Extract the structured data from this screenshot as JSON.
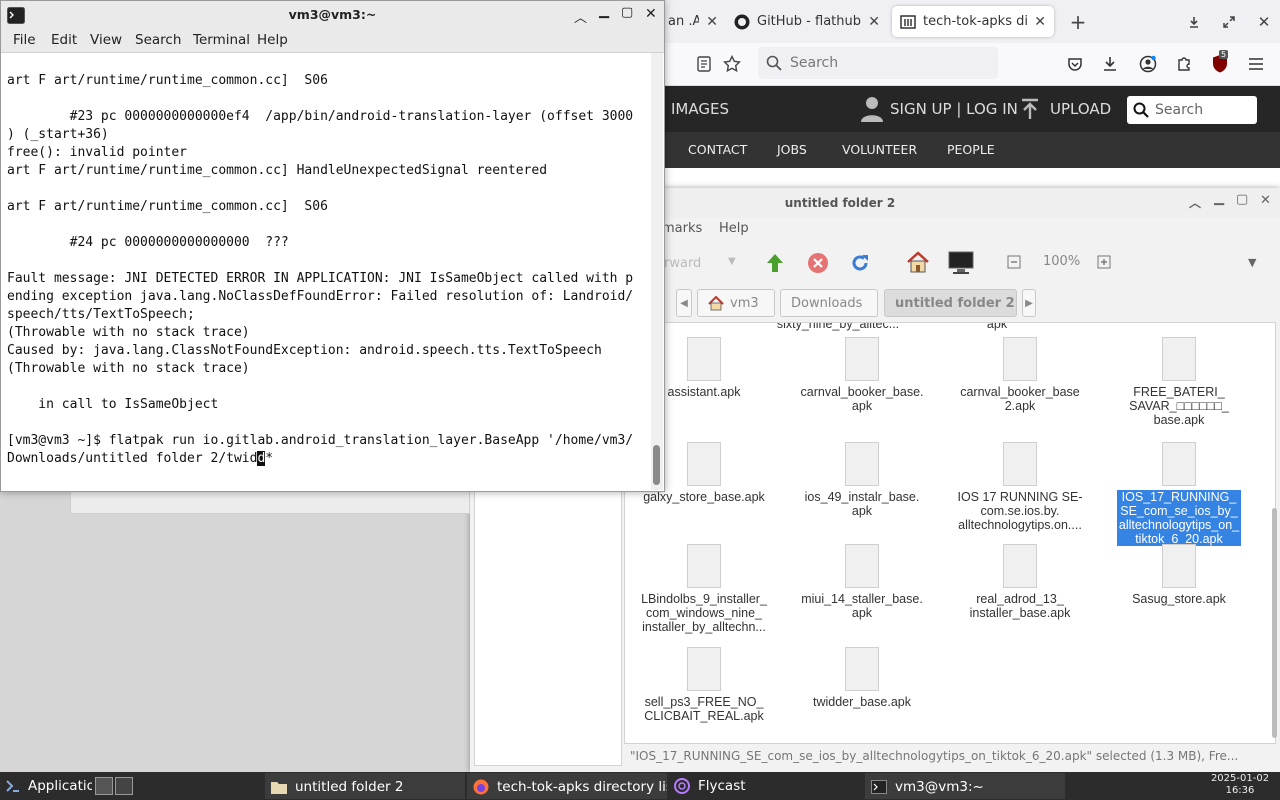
{
  "firefox": {
    "tabs": [
      {
        "label": "an .A",
        "active": false
      },
      {
        "label": "GitHub - flathub/io",
        "active": false
      },
      {
        "label": "tech-tok-apks dire",
        "active": true
      }
    ],
    "search_placeholder": "Search",
    "notification_badge": "5",
    "site": {
      "nav_images": "IMAGES",
      "sign_in": "SIGN UP | LOG IN",
      "upload": "UPLOAD",
      "search_placeholder": "Search",
      "subnav": [
        "CONTACT",
        "JOBS",
        "VOLUNTEER",
        "PEOPLE"
      ]
    }
  },
  "file_manager": {
    "title": "untitled folder 2",
    "menu": [
      "marks",
      "Help"
    ],
    "toolbar": {
      "forward": "rward",
      "zoom": "100%"
    },
    "breadcrumbs": [
      "vm3",
      "Downloads",
      "untitled folder 2"
    ],
    "partial_top": [
      "sixty_nine_by_alltec...",
      "apk"
    ],
    "files": [
      {
        "name": "assistant.apk",
        "selected": false
      },
      {
        "name": "carnval_booker_base.\napk",
        "selected": false
      },
      {
        "name": "carnval_booker_base\n2.apk",
        "selected": false
      },
      {
        "name": "FREE_BATERI_\nSAVAR_□□□□□□_\nbase.apk",
        "selected": false
      },
      {
        "name": "galxy_store_base.apk",
        "selected": false
      },
      {
        "name": "ios_49_instalr_base.\napk",
        "selected": false
      },
      {
        "name": "IOS 17 RUNNING SE-\ncom.se.ios.by.\nalltechnologytips.on....",
        "selected": false
      },
      {
        "name": "IOS_17_RUNNING_\nSE_com_se_ios_by_\nalltechnologytips_on_\ntiktok_6_20.apk",
        "selected": true
      },
      {
        "name": "LBindolbs_9_installer_\ncom_windows_nine_\ninstaller_by_alltechn...",
        "selected": false
      },
      {
        "name": "miui_14_staller_base.\napk",
        "selected": false
      },
      {
        "name": "real_adrod_13_\ninstaller_base.apk",
        "selected": false
      },
      {
        "name": "Sasug_store.apk",
        "selected": false
      },
      {
        "name": "sell_ps3_FREE_NO_\nCLICBAIT_REAL.apk",
        "selected": false
      },
      {
        "name": "twidder_base.apk",
        "selected": false
      }
    ],
    "status": "\"IOS_17_RUNNING_SE_com_se_ios_by_alltechnologytips_on_tiktok_6_20.apk\" selected (1.3 MB), Fre..."
  },
  "terminal": {
    "title": "vm3@vm3:~",
    "menu": [
      "File",
      "Edit",
      "View",
      "Search",
      "Terminal",
      "Help"
    ],
    "lines": [
      "",
      "art F art/runtime/runtime_common.cc]  S06",
      "",
      "        #23 pc 0000000000000ef4  /app/bin/android-translation-layer (offset 3000",
      ") (_start+36)",
      "free(): invalid pointer",
      "art F art/runtime/runtime_common.cc] HandleUnexpectedSignal reentered",
      "",
      "art F art/runtime/runtime_common.cc]  S06",
      "",
      "        #24 pc 0000000000000000  ???",
      "",
      "Fault message: JNI DETECTED ERROR IN APPLICATION: JNI IsSameObject called with p",
      "ending exception java.lang.NoClassDefFoundError: Failed resolution of: Landroid/",
      "speech/tts/TextToSpeech;",
      "(Throwable with no stack trace)",
      "Caused by: java.lang.ClassNotFoundException: android.speech.tts.TextToSpeech",
      "(Throwable with no stack trace)",
      "",
      "    in call to IsSameObject",
      "",
      "[vm3@vm3 ~]$ flatpak run io.gitlab.android_translation_layer.BaseApp '/home/vm3/"
    ],
    "last_line_before": "Downloads/untitled folder 2/twid",
    "last_line_cursor": "d",
    "last_line_after": "*"
  },
  "taskbar": {
    "applications": "Applications",
    "windows": [
      {
        "label": "untitled folder 2",
        "icon": "folder-icon"
      },
      {
        "label": "tech-tok-apks directory listi...",
        "icon": "firefox-icon"
      },
      {
        "label": "Flycast",
        "icon": "flycast-icon"
      },
      {
        "label": "vm3@vm3:~",
        "icon": "terminal-icon"
      }
    ],
    "date": "2025-01-02",
    "time": "16:36"
  }
}
